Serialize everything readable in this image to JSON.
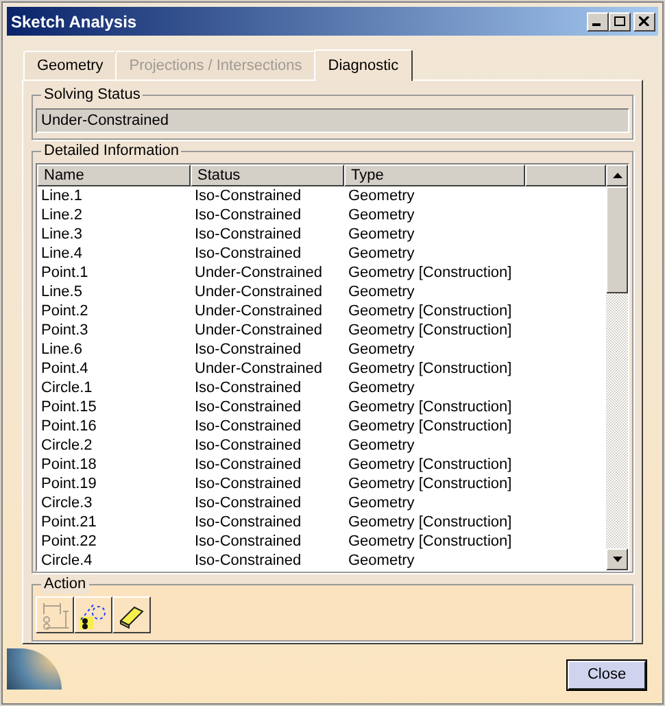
{
  "window": {
    "title": "Sketch Analysis"
  },
  "tabs": [
    {
      "label": "Geometry",
      "selected": false,
      "disabled": false
    },
    {
      "label": "Projections / Intersections",
      "selected": false,
      "disabled": true
    },
    {
      "label": "Diagnostic",
      "selected": true,
      "disabled": false
    }
  ],
  "solving_status": {
    "title": "Solving Status",
    "value": "Under-Constrained"
  },
  "detailed_information": {
    "title": "Detailed Information",
    "columns": [
      "Name",
      "Status",
      "Type"
    ],
    "rows": [
      [
        "Line.1",
        "Iso-Constrained",
        "Geometry"
      ],
      [
        "Line.2",
        "Iso-Constrained",
        "Geometry"
      ],
      [
        "Line.3",
        "Iso-Constrained",
        "Geometry"
      ],
      [
        "Line.4",
        "Iso-Constrained",
        "Geometry"
      ],
      [
        "Point.1",
        "Under-Constrained",
        "Geometry [Construction]"
      ],
      [
        "Line.5",
        "Under-Constrained",
        "Geometry"
      ],
      [
        "Point.2",
        "Under-Constrained",
        "Geometry [Construction]"
      ],
      [
        "Point.3",
        "Under-Constrained",
        "Geometry [Construction]"
      ],
      [
        "Line.6",
        "Iso-Constrained",
        "Geometry"
      ],
      [
        "Point.4",
        "Under-Constrained",
        "Geometry [Construction]"
      ],
      [
        "Circle.1",
        "Iso-Constrained",
        "Geometry"
      ],
      [
        "Point.15",
        "Iso-Constrained",
        "Geometry [Construction]"
      ],
      [
        "Point.16",
        "Iso-Constrained",
        "Geometry [Construction]"
      ],
      [
        "Circle.2",
        "Iso-Constrained",
        "Geometry"
      ],
      [
        "Point.18",
        "Iso-Constrained",
        "Geometry [Construction]"
      ],
      [
        "Point.19",
        "Iso-Constrained",
        "Geometry [Construction]"
      ],
      [
        "Circle.3",
        "Iso-Constrained",
        "Geometry"
      ],
      [
        "Point.21",
        "Iso-Constrained",
        "Geometry [Construction]"
      ],
      [
        "Point.22",
        "Iso-Constrained",
        "Geometry [Construction]"
      ],
      [
        "Circle.4",
        "Iso-Constrained",
        "Geometry"
      ]
    ]
  },
  "action": {
    "title": "Action",
    "buttons": [
      {
        "kind": "dimensions",
        "disabled": true
      },
      {
        "kind": "fix",
        "disabled": false
      },
      {
        "kind": "erase",
        "disabled": false
      }
    ]
  },
  "buttons": [
    "Close"
  ]
}
